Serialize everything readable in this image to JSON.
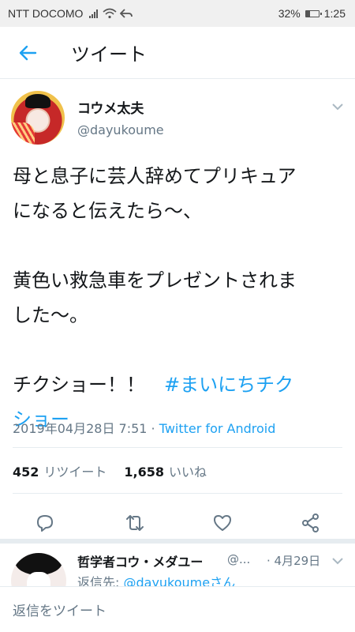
{
  "status_bar": {
    "carrier": "NTT DOCOMO",
    "battery": "32%",
    "battery_level": 0.32,
    "time": "1:25",
    "icons": [
      "signal-icon",
      "wifi-icon",
      "data-arrow-icon",
      "battery-icon"
    ]
  },
  "app_bar": {
    "back_icon": "arrow-left-icon",
    "title": "ツイート"
  },
  "tweet": {
    "author_name": "コウメ太夫",
    "author_handle": "@dayukoume",
    "text_lines": [
      "母と息子に芸人辞めてプリキュア\nになると伝えたら〜、",
      "黄色い救急車をプレゼントされま\nした〜。",
      "チクショー！！　"
    ],
    "hashtag": "#まいにちチク\nショー",
    "timestamp": "2019年04月28日 7:51 · ",
    "source": "Twitter for Android",
    "retweets_count": "452",
    "retweets_label": "リツイート",
    "likes_count": "1,658",
    "likes_label": "いいね",
    "actions": [
      "reply-icon",
      "retweet-icon",
      "like-icon",
      "share-icon"
    ]
  },
  "reply": {
    "author_name": "哲学者コウ・メダユー",
    "author_handle": "@...",
    "date": "· 4月29日",
    "reply_to_prefix": "返信先: ",
    "reply_to_handle": "@dayukoumeさん"
  },
  "composer": {
    "placeholder": "返信をツイート"
  },
  "colors": {
    "accent": "#1da1f2",
    "text_primary": "#14171a",
    "text_secondary": "#657786",
    "divider": "#e6ecf0"
  }
}
